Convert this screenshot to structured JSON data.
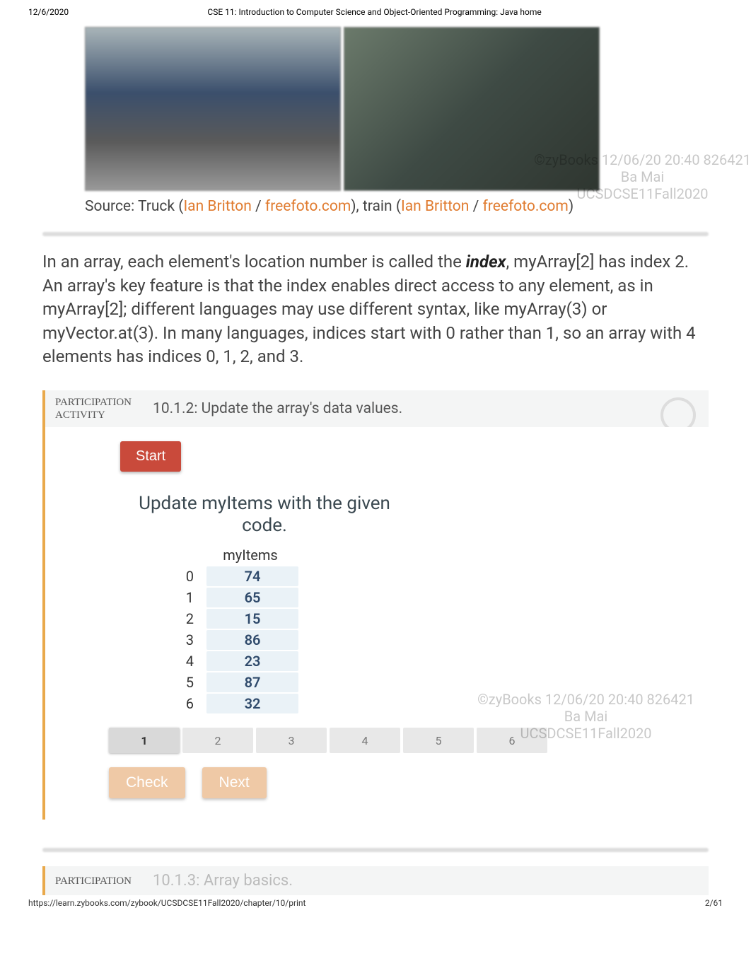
{
  "header": {
    "date": "12/6/2020",
    "course_title": "CSE 11: Introduction to Computer Science and Object-Oriented Programming: Java home"
  },
  "footer": {
    "url": "https://learn.zybooks.com/zybook/UCSDCSE11Fall2020/chapter/10/print",
    "page": "2/61"
  },
  "caption": {
    "prefix": "Source: Truck (",
    "link1": "Ian Britton",
    "sep1": " / ",
    "link2": "freefoto.com",
    "mid": "), train (",
    "link3": "Ian Britton",
    "sep2": " / ",
    "link4": "freefoto.com",
    "suffix": ")"
  },
  "watermark": {
    "line1": "©zyBooks 12/06/20 20:40 826421",
    "line2": "Ba Mai",
    "line3": "UCSDCSE11Fall2020"
  },
  "paragraph": {
    "pre": "In an array, each element's location number is called the ",
    "term": "index",
    "post": ", myArray[2] has index 2. An array's key feature is that the index enables direct access to any element, as in myArray[2]; different languages may use different syntax, like myArray(3) or myVector.at(3). In many languages, indices start with 0 rather than 1, so an array with 4 elements has indices 0, 1, 2, and 3."
  },
  "activity1": {
    "label": "PARTICIPATION\nACTIVITY",
    "title": "10.1.2: Update the array's data values.",
    "start": "Start",
    "instruction": "Update myItems with the given code.",
    "array_name": "myItems",
    "items": [
      {
        "idx": "0",
        "val": "74"
      },
      {
        "idx": "1",
        "val": "65"
      },
      {
        "idx": "2",
        "val": "15"
      },
      {
        "idx": "3",
        "val": "86"
      },
      {
        "idx": "4",
        "val": "23"
      },
      {
        "idx": "5",
        "val": "87"
      },
      {
        "idx": "6",
        "val": "32"
      }
    ],
    "steps": [
      "1",
      "2",
      "3",
      "4",
      "5",
      "6"
    ],
    "check": "Check",
    "next": "Next"
  },
  "activity2": {
    "label": "PARTICIPATION",
    "ghost": "10.1.3: Array basics."
  }
}
